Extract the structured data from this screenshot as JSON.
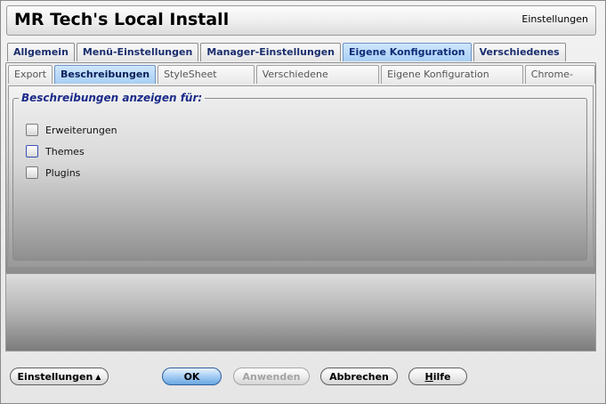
{
  "header": {
    "title": "MR Tech's Local Install",
    "section": "Einstellungen"
  },
  "tabs_top": [
    {
      "label": "Allgemein"
    },
    {
      "label": "Menü-Einstellungen"
    },
    {
      "label": "Manager-Einstellungen"
    },
    {
      "label": "Eigene Konfiguration"
    },
    {
      "label": "Verschiedenes"
    }
  ],
  "tabs_sub": [
    {
      "label": "Export"
    },
    {
      "label": "Beschreibungen"
    },
    {
      "label": "StyleSheet anpassen"
    },
    {
      "label": "Verschiedene Einstellungen"
    },
    {
      "label": "Eigene Konfiguration bearbeiten"
    },
    {
      "label": "Chrome-Editor"
    }
  ],
  "group": {
    "legend": "Beschreibungen anzeigen für:",
    "items": [
      {
        "label": "Erweiterungen"
      },
      {
        "label": "Themes"
      },
      {
        "label": "Plugins"
      }
    ]
  },
  "buttons": {
    "settings": "Einstellungen",
    "settings_caret": "▲",
    "ok": "OK",
    "apply": "Anwenden",
    "cancel": "Abbrechen",
    "help_prefix": "",
    "help_key": "H",
    "help_rest": "ilfe"
  }
}
